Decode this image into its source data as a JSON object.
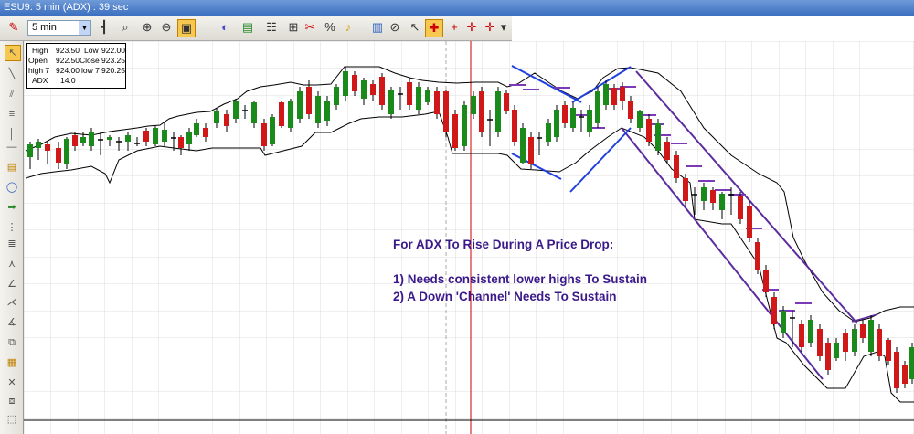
{
  "window": {
    "title": "ESU9: 5 min (ADX) : 39 sec"
  },
  "toolbar": {
    "interval_value": "5 min",
    "icons": [
      "pin-icon",
      "bar-style-icon",
      "zoom-icon",
      "zoom-in-icon",
      "zoom-out-icon",
      "lock-icon",
      "indicator-icon",
      "color-icon",
      "layout-icon",
      "grid-icon",
      "cut-icon",
      "bell-icon",
      "save-icon",
      "link-icon",
      "pointer-icon",
      "crosshair-icon",
      "target-icon",
      "marker-icon"
    ]
  },
  "left_tools": [
    "pointer-tool",
    "line-tool",
    "parallel-tool",
    "fib-tool",
    "vertical-line-tool",
    "text-tool",
    "ellipse-tool",
    "arrow-tool",
    "gann-tool",
    "wave-tool",
    "fan-tool",
    "speed-tool",
    "pitchfork-tool",
    "andrews-tool",
    "copy-tool",
    "note-tool",
    "delete-tool",
    "layers-tool",
    "clone-tool",
    "select-tool"
  ],
  "info_box": {
    "high_label": "High",
    "high_value": "923.50",
    "low_label": "Low",
    "low_value": "922.00",
    "open_label": "Open",
    "open_value": "922.50",
    "close_label": "Close",
    "close_value": "923.25",
    "high7_label": "high 7",
    "high7_value": "924.00",
    "low7_label": "low 7",
    "low7_value": "920.25",
    "adx_label": "ADX",
    "adx_value": "14.0"
  },
  "annotation": {
    "title": "For ADX To Rise During A Price Drop:",
    "line1": "1) Needs consistent lower highs To Sustain",
    "line2": "2) A Down 'Channel' Needs To Sustain"
  },
  "colors": {
    "up": "#1a8a1a",
    "down": "#d01818",
    "channel": "#5c2c9e",
    "trend": "#1f3fe0",
    "marker": "#7a3ab8",
    "grid": "#d8d8d8",
    "separator": "#cc0000"
  }
}
